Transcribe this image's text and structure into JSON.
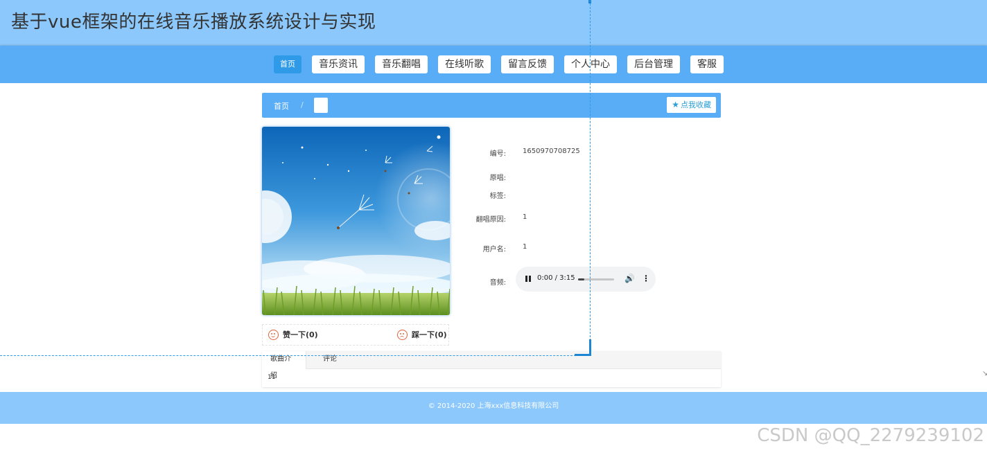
{
  "header": {
    "site_title": "基于vue框架的在线音乐播放系统设计与实现"
  },
  "nav": {
    "items": [
      {
        "label": "首页",
        "active": true
      },
      {
        "label": "音乐资讯"
      },
      {
        "label": "音乐翻唱"
      },
      {
        "label": "在线听歌"
      },
      {
        "label": "留言反馈"
      },
      {
        "label": "个人中心"
      },
      {
        "label": "后台管理"
      },
      {
        "label": "客服"
      }
    ]
  },
  "breadcrumb": {
    "home": "首页",
    "separator": "/",
    "favorite_label": "点我收藏",
    "favorite_icon": "star-icon"
  },
  "detail": {
    "fields": [
      {
        "label": "编号:",
        "value": "1650970708725"
      },
      {
        "label": "原唱:",
        "value": ""
      },
      {
        "label": "标签:",
        "value": ""
      },
      {
        "label": "翻唱原因:",
        "value": "1"
      },
      {
        "label": "用户名:",
        "value": "1"
      },
      {
        "label": "音频:",
        "value": ""
      }
    ]
  },
  "audio": {
    "time": "0:00 / 3:15",
    "progress": 0.18,
    "play_state_icon": "pause-icon",
    "volume_icon": "volume-icon",
    "menu_icon": "more-vert-icon"
  },
  "votes": {
    "like_label": "赞一下(0)",
    "dislike_label": "踩一下(0)",
    "like_icon": "smile-face-icon",
    "dislike_icon": "sad-face-icon"
  },
  "tabs": {
    "items": [
      {
        "label": "歌曲介绍",
        "active": true
      },
      {
        "label": "评论"
      }
    ],
    "content": "11"
  },
  "footer": {
    "copyright": "© 2014-2020 上海xxx信息科技有限公司"
  },
  "watermark": "CSDN @QQ_2279239102",
  "colors": {
    "header_bg": "#8cc8fb",
    "nav_bg": "#58adf6",
    "active_nav": "#2f9be8",
    "accent": "#2a9fd6",
    "vote_face": "#e0623d"
  }
}
